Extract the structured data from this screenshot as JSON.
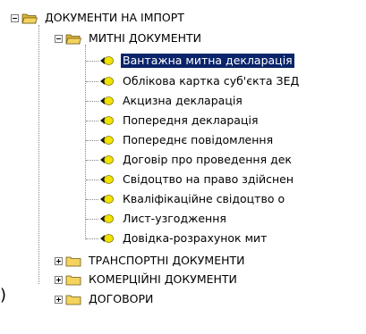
{
  "tree": {
    "root": {
      "label": "ДОКУМЕНТИ НА ІМПОРТ",
      "expanded": true
    },
    "customs": {
      "label": "МИТНІ ДОКУМЕНТИ",
      "expanded": true,
      "items": [
        {
          "label": "Вантажна митна декларація",
          "selected": true
        },
        {
          "label": "Облікова картка суб'єкта ЗЕД"
        },
        {
          "label": "Акцизна декларація"
        },
        {
          "label": "Попередня декларація"
        },
        {
          "label": "Попереднє повідомлення"
        },
        {
          "label": "Договір про проведення дек"
        },
        {
          "label": "Свідоцтво на право здійснен"
        },
        {
          "label": "Кваліфікаційне свідоцтво о"
        },
        {
          "label": "Лист-узгодження"
        },
        {
          "label": "Довідка-розрахунок мит"
        }
      ]
    },
    "transport": {
      "label": "ТРАНСПОРТНІ ДОКУМЕНТИ",
      "expanded": false
    },
    "commercial": {
      "label": "КОМЕРЦІЙНІ ДОКУМЕНТИ",
      "expanded": false
    },
    "contracts": {
      "label": "ДОГОВОРИ",
      "expanded": false
    }
  },
  "edge_mark": ")",
  "colors": {
    "selection": "#0a246a",
    "folder_fill": "#f4d35e",
    "bullet_yellow": "#f2e200"
  }
}
